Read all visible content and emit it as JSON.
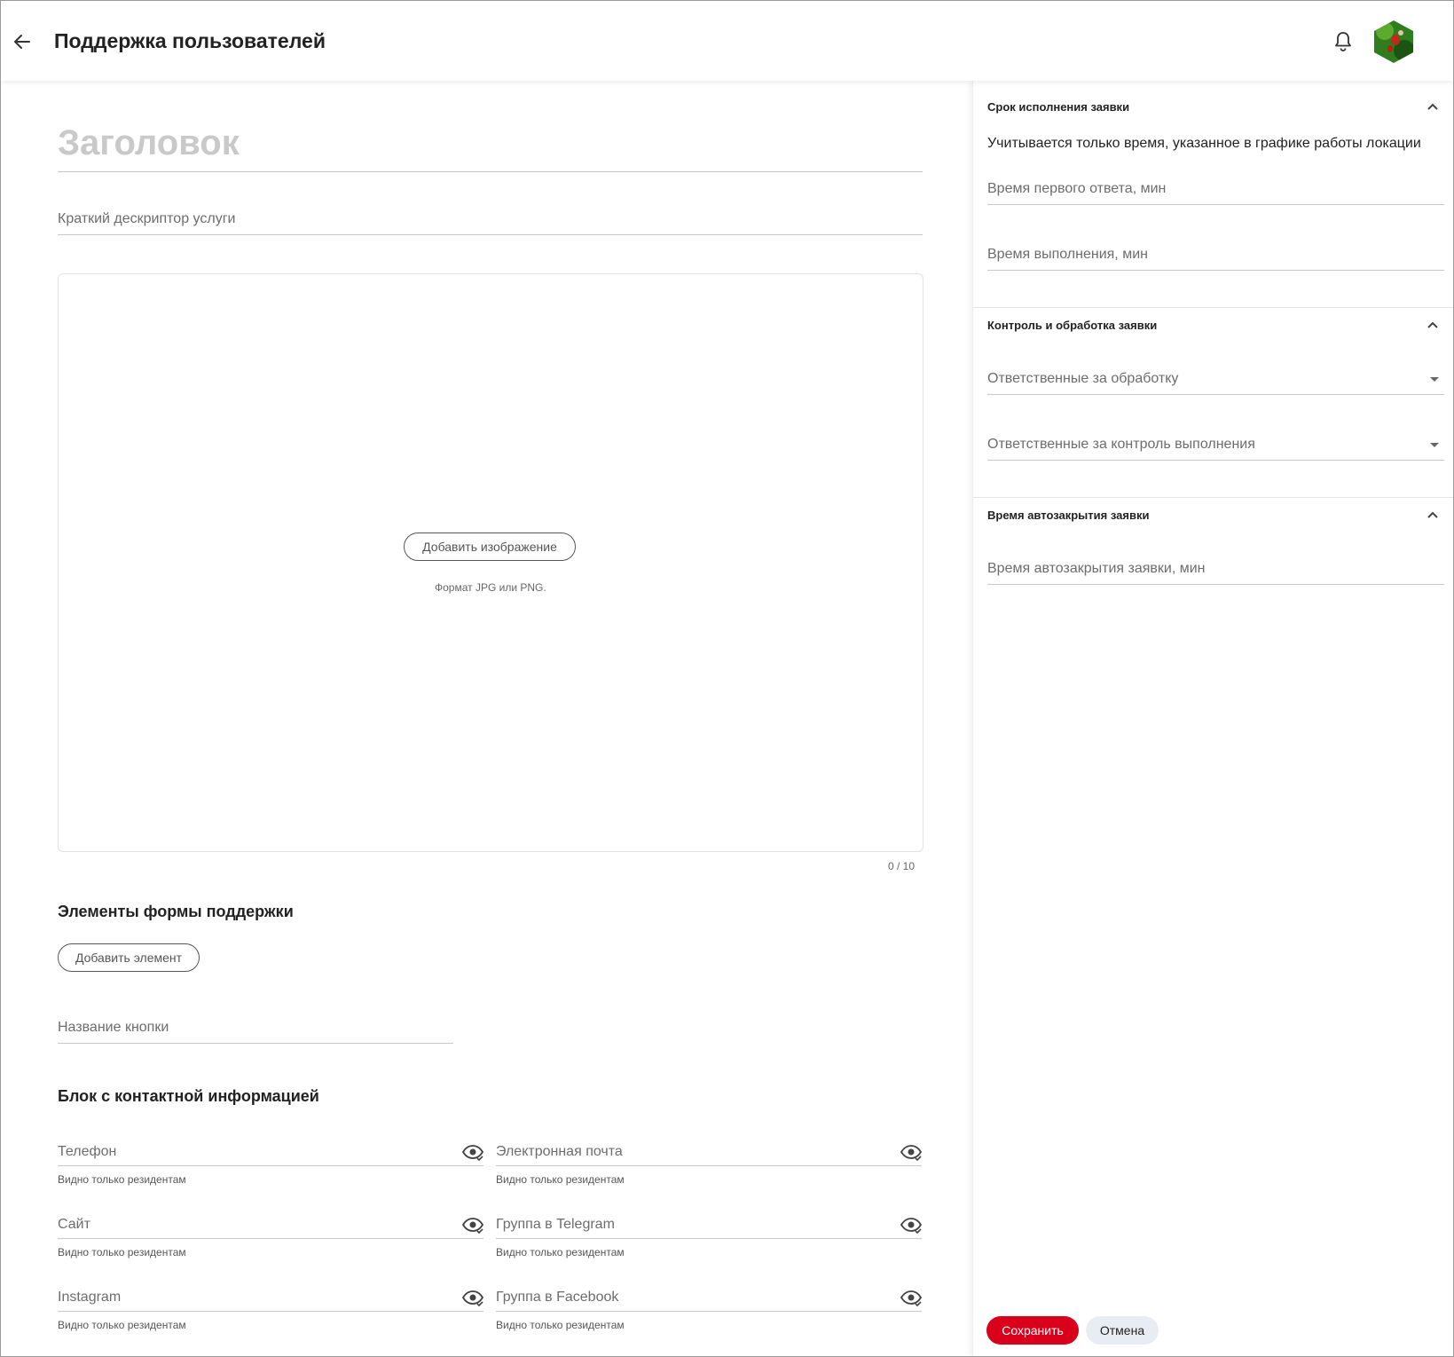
{
  "header": {
    "title": "Поддержка пользователей"
  },
  "main": {
    "title_placeholder": "Заголовок",
    "descriptor_placeholder": "Краткий дескриптор услуги",
    "add_image_label": "Добавить изображение",
    "image_format_hint": "Формат JPG или PNG.",
    "image_counter": "0 / 10",
    "form_elements_title": "Элементы формы поддержки",
    "add_element_label": "Добавить элемент",
    "button_name_placeholder": "Название кнопки",
    "contact_block_title": "Блок с контактной информацией",
    "contacts": [
      {
        "label": "Телефон",
        "note": "Видно только резидентам"
      },
      {
        "label": "Электронная почта",
        "note": "Видно только резидентам"
      },
      {
        "label": "Сайт",
        "note": "Видно только резидентам"
      },
      {
        "label": "Группа в Telegram",
        "note": "Видно только резидентам"
      },
      {
        "label": "Instagram",
        "note": "Видно только резидентам"
      },
      {
        "label": "Группа в Facebook",
        "note": "Видно только резидентам"
      }
    ]
  },
  "side": {
    "deadline": {
      "title": "Срок исполнения заявки",
      "note": "Учитывается только время, указанное в графике работы локации",
      "first_response_placeholder": "Время первого ответа, мин",
      "execution_placeholder": "Время выполнения, мин"
    },
    "control": {
      "title": "Контроль и обработка заявки",
      "processing_placeholder": "Ответственные за обработку",
      "control_placeholder": "Ответственные за контроль выполнения"
    },
    "autoclose": {
      "title": "Время автозакрытия заявки",
      "autoclose_placeholder": "Время автозакрытия заявки, мин"
    },
    "save_label": "Сохранить",
    "cancel_label": "Отмена"
  },
  "colors": {
    "accent_red": "#d9001b",
    "cancel_bg": "#e8edf3",
    "placeholder_gray": "#6d6d6d"
  }
}
